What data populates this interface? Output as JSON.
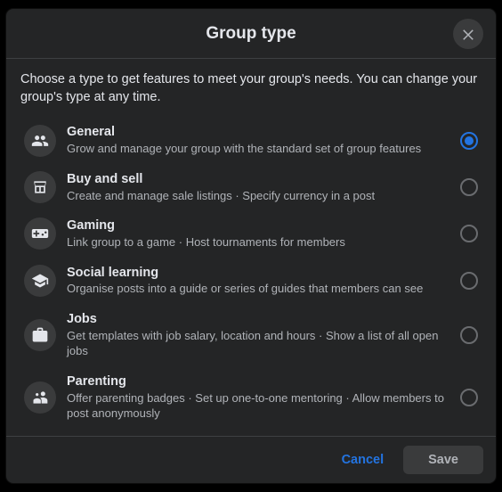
{
  "header": {
    "title": "Group type"
  },
  "intro": "Choose a type to get features to meet your group's needs. You can change your group's type at any time.",
  "options": [
    {
      "title": "General",
      "desc": "Grow and manage your group with the standard set of group features",
      "selected": true
    },
    {
      "title": "Buy and sell",
      "desc": "Create and manage sale listings · Specify currency in a post",
      "selected": false
    },
    {
      "title": "Gaming",
      "desc": "Link group to a game · Host tournaments for members",
      "selected": false
    },
    {
      "title": "Social learning",
      "desc": "Organise posts into a guide or series of guides that members can see",
      "selected": false
    },
    {
      "title": "Jobs",
      "desc": "Get templates with job salary, location and hours · Show a list of all open jobs",
      "selected": false
    },
    {
      "title": "Parenting",
      "desc": "Offer parenting badges · Set up one-to-one mentoring · Allow members to post anonymously",
      "selected": false
    }
  ],
  "footer": {
    "cancel": "Cancel",
    "save": "Save"
  }
}
